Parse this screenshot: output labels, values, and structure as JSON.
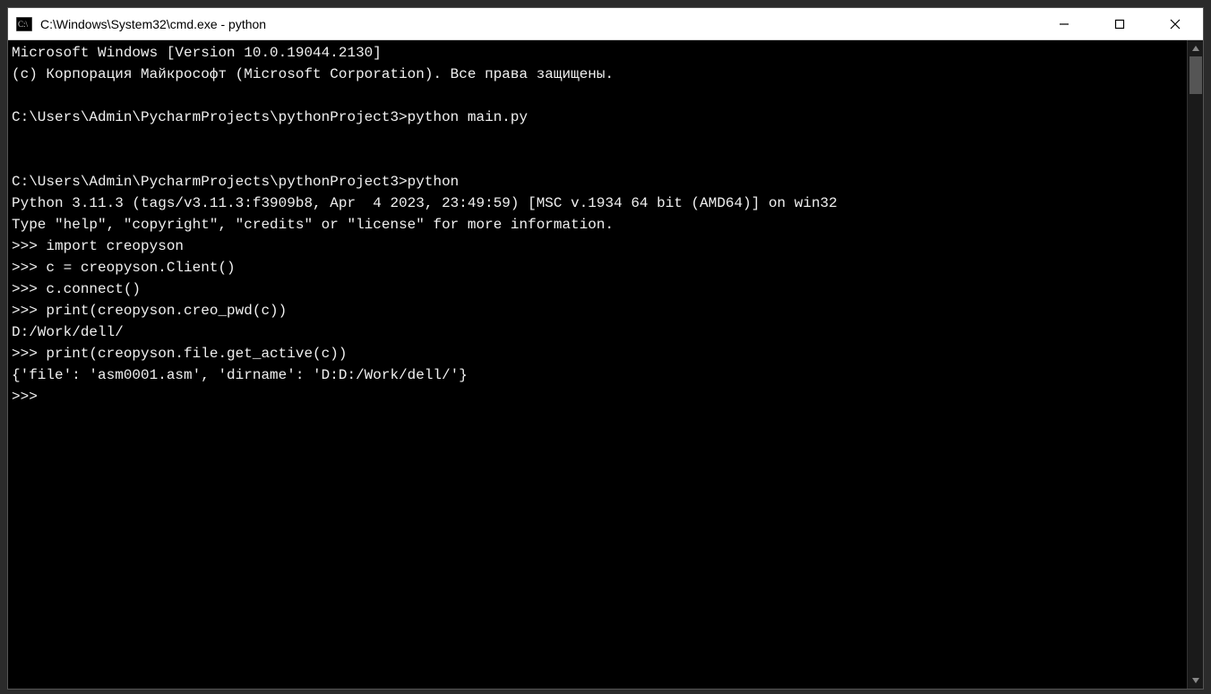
{
  "window": {
    "title": "C:\\Windows\\System32\\cmd.exe - python"
  },
  "terminal": {
    "lines": [
      "Microsoft Windows [Version 10.0.19044.2130]",
      "(c) Корпорация Майкрософт (Microsoft Corporation). Все права защищены.",
      "",
      "C:\\Users\\Admin\\PycharmProjects\\pythonProject3>python main.py",
      "",
      "",
      "C:\\Users\\Admin\\PycharmProjects\\pythonProject3>python",
      "Python 3.11.3 (tags/v3.11.3:f3909b8, Apr  4 2023, 23:49:59) [MSC v.1934 64 bit (AMD64)] on win32",
      "Type \"help\", \"copyright\", \"credits\" or \"license\" for more information.",
      ">>> import creopyson",
      ">>> c = creopyson.Client()",
      ">>> c.connect()",
      ">>> print(creopyson.creo_pwd(c))",
      "D:/Work/dell/",
      ">>> print(creopyson.file.get_active(c))",
      "{'file': 'asm0001.asm', 'dirname': 'D:D:/Work/dell/'}",
      ">>>"
    ]
  }
}
